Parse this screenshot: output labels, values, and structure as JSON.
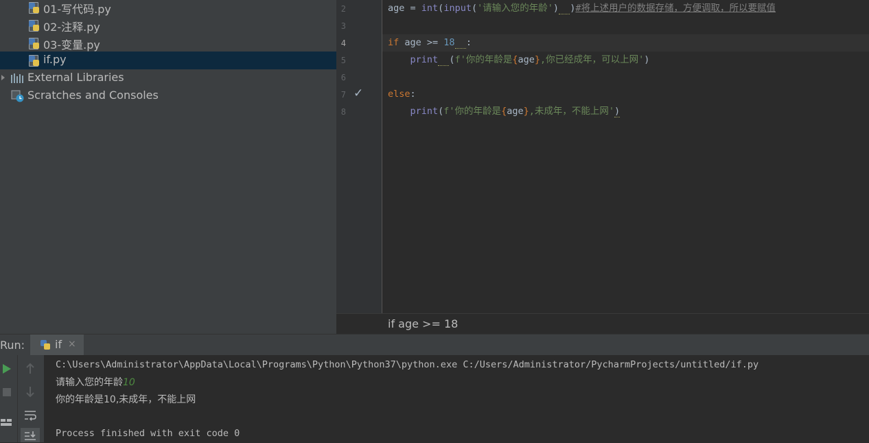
{
  "project_tree": {
    "items": [
      {
        "label": "01-写代码.py",
        "type": "python-file"
      },
      {
        "label": "02-注释.py",
        "type": "python-file"
      },
      {
        "label": "03-变量.py",
        "type": "python-file"
      },
      {
        "label": "if.py",
        "type": "python-file",
        "selected": true
      },
      {
        "label": "External Libraries",
        "type": "libraries"
      },
      {
        "label": "Scratches and Consoles",
        "type": "scratches"
      }
    ]
  },
  "editor": {
    "line_numbers": [
      "2",
      "3",
      "4",
      "5",
      "6",
      "7",
      "8"
    ],
    "current_line": "4",
    "code": {
      "line2": {
        "a": "age = ",
        "b": "int",
        "c": "(",
        "d": "input",
        "e": "(",
        "f": "'请输入您的年龄'",
        "g": ")",
        "h": "  ",
        "i": ")",
        "j": "#将上述用户的数据存储，方便调取，所以要赋值"
      },
      "line4": {
        "kw": "if",
        "a": " age >= ",
        "num": "18",
        "b": "  ",
        "c": ":"
      },
      "line5": {
        "indent": "    ",
        "fn": "print",
        "sq": "  ",
        "a": "(",
        "str1": "f'你的年龄是",
        "brace_o": "{",
        "var": "age",
        "brace_c": "}",
        "str2": ",你已经成年，可以上网'",
        "b": ")"
      },
      "line7": {
        "kw": "else",
        "a": ":"
      },
      "line8": {
        "indent": "    ",
        "fn": "print",
        "a": "(",
        "str1": "f'你的年龄是",
        "brace_o": "{",
        "var": "age",
        "brace_c": "}",
        "str2": ",未成年，不能上网'",
        "b": ")"
      }
    },
    "breadcrumb": "if age >= 18"
  },
  "run_panel": {
    "title": "Run:",
    "tab_label": "if",
    "close_glyph": "×",
    "console": {
      "command": "C:\\Users\\Administrator\\AppData\\Local\\Programs\\Python\\Python37\\python.exe C:/Users/Administrator/PycharmProjects/untitled/if.py",
      "prompt": "请输入您的年龄",
      "user_input": "10",
      "output": "你的年龄是10,未成年，不能上网",
      "exit": "Process finished with exit code 0"
    }
  },
  "colors": {
    "editor_bg": "#2b2b2b",
    "panel_bg": "#3c3f41",
    "selection": "#0d293e",
    "keyword": "#cc7832",
    "string": "#6a8759",
    "number": "#6897bb",
    "builtin": "#8888c6",
    "run_green": "#499c54"
  }
}
